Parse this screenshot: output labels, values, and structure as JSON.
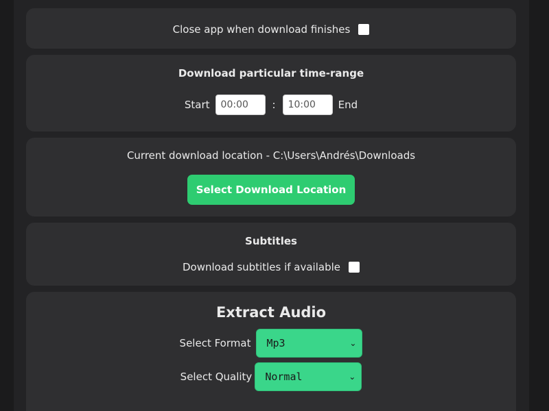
{
  "close_app": {
    "label": "Close app when download finishes",
    "checked": false
  },
  "time_range": {
    "title": "Download particular time-range",
    "start_label": "Start",
    "start_value": "00:00",
    "separator": ":",
    "end_value": "10:00",
    "end_label": "End"
  },
  "location": {
    "text": "Current download location - C:\\Users\\Andrés\\Downloads",
    "button_label": "Select Download Location"
  },
  "subtitles": {
    "title": "Subtitles",
    "label": "Download subtitles if available",
    "checked": false
  },
  "audio": {
    "title": "Extract Audio",
    "format_label": "Select Format",
    "format_value": "Mp3",
    "quality_label": "Select Quality",
    "quality_value": "Normal"
  },
  "colors": {
    "background": "#1b1b1c",
    "panel": "#232325",
    "card": "#2f2f31",
    "accent_green": "#2ecc71",
    "select_green": "#3ad68a"
  }
}
